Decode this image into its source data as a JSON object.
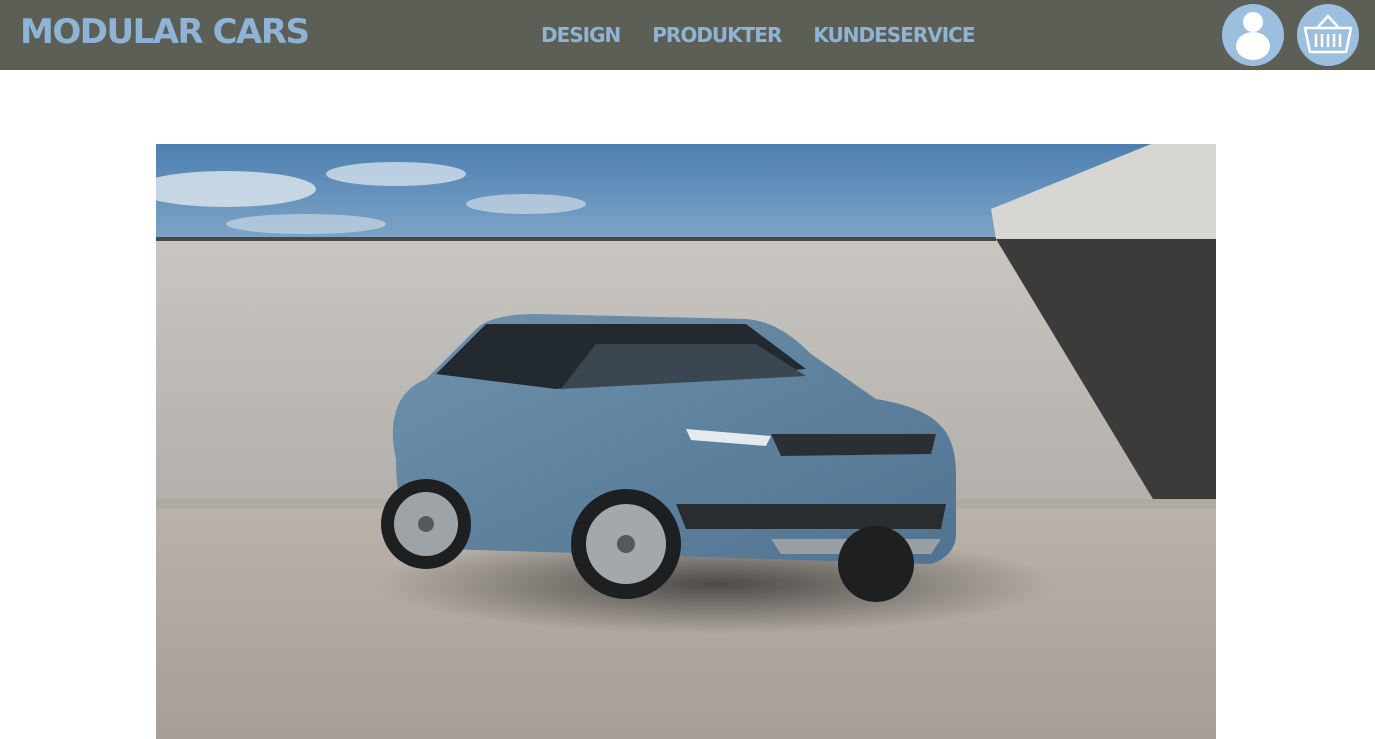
{
  "brand": {
    "name": "MODULAR CARS"
  },
  "nav": {
    "items": [
      {
        "label": "DESIGN"
      },
      {
        "label": "PRODUKTER"
      },
      {
        "label": "KUNDESERVICE"
      }
    ]
  },
  "header": {
    "user_icon": "user-icon",
    "cart_icon": "shopping-basket-icon"
  },
  "colors": {
    "header_bg": "#5c5f56",
    "accent": "#8fb3d4",
    "icon_bg": "#9dbfdf"
  },
  "hero": {
    "image": "blue-suv-photo"
  }
}
